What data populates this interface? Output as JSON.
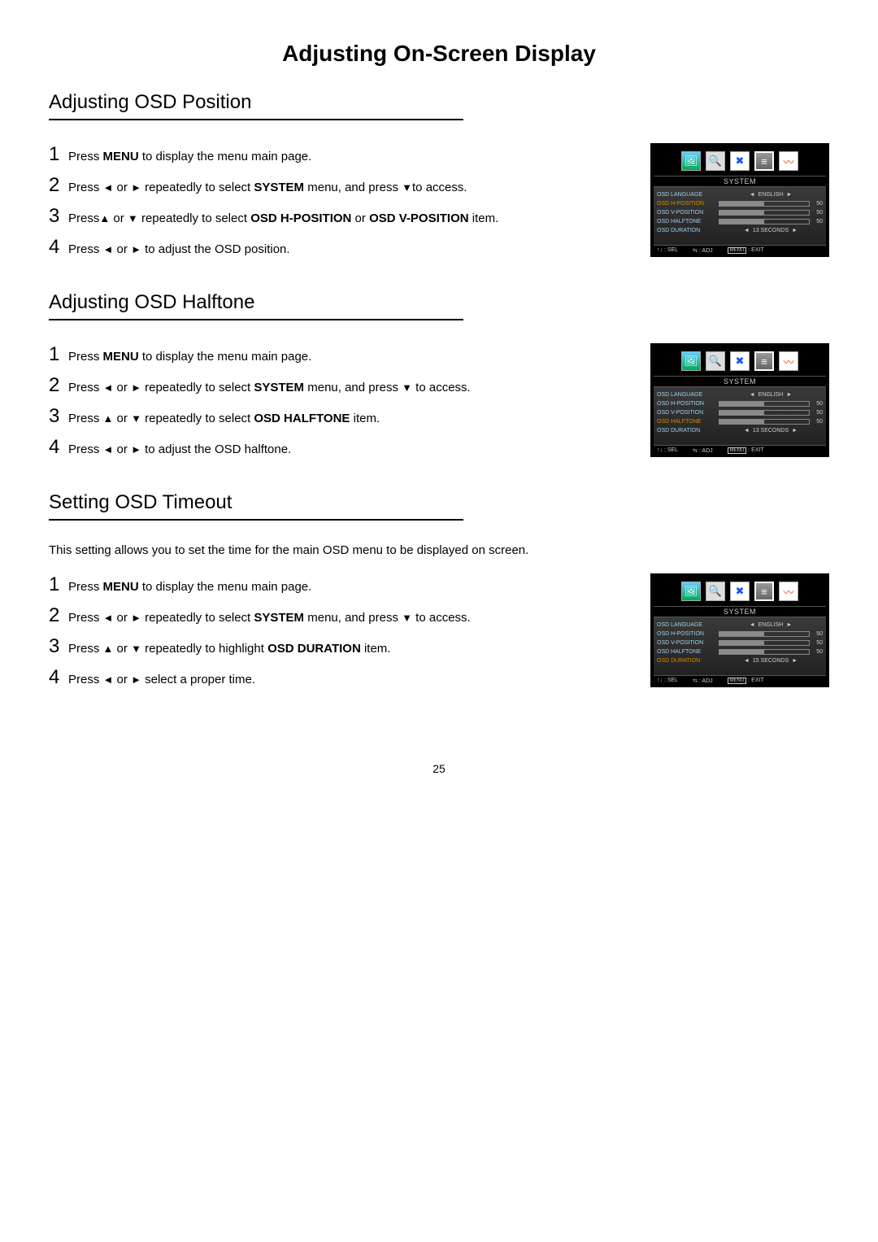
{
  "page_title": "Adjusting On-Screen Display",
  "page_number": "25",
  "arrows": {
    "left": "◄",
    "right": "►",
    "up": "▲",
    "down": "▼",
    "updown": "↑↓",
    "lr_icon": "⇆"
  },
  "sections": {
    "position": {
      "heading": "Adjusting OSD Position",
      "steps": [
        {
          "n": "1",
          "pre": "Press ",
          "b1": "MENU",
          "post1": " to display the menu main page."
        },
        {
          "n": "2",
          "pre": "Press ",
          "arr1": "◄",
          "mid1": " or ",
          "arr2": "►",
          "mid2": " repeatedly to select ",
          "b1": "SYSTEM",
          "post1": " menu, and press ",
          "arr3": "▼",
          "post2": "to access."
        },
        {
          "n": "3",
          "pre": "Press",
          "arr1": "▲",
          "mid1": " or ",
          "arr2": "▼",
          "mid2": " repeatedly to select ",
          "b1": "OSD H-POSITION",
          "mid3": " or ",
          "b2": "OSD V-POSITION",
          "post1": " item."
        },
        {
          "n": "4",
          "pre": "Press ",
          "arr1": "◄",
          "mid1": " or ",
          "arr2": "►",
          "post1": " to adjust the OSD position."
        }
      ]
    },
    "halftone": {
      "heading": "Adjusting OSD Halftone",
      "steps": [
        {
          "n": "1",
          "pre": "Press ",
          "b1": "MENU",
          "post1": " to display the menu main page."
        },
        {
          "n": "2",
          "pre": "Press ",
          "arr1": "◄",
          "mid1": " or ",
          "arr2": "►",
          "mid2": " repeatedly to select ",
          "b1": "SYSTEM",
          "post1": " menu, and press ",
          "arr3": "▼",
          "post2": " to access."
        },
        {
          "n": "3",
          "pre": "Press ",
          "arr1": "▲",
          "mid1": " or ",
          "arr2": "▼",
          "mid2": " repeatedly to select ",
          "b1": "OSD HALFTONE",
          "post1": " item."
        },
        {
          "n": "4",
          "pre": "Press ",
          "arr1": "◄",
          "mid1": " or ",
          "arr2": "►",
          "post1": " to adjust the OSD halftone."
        }
      ]
    },
    "timeout": {
      "heading": "Setting OSD Timeout",
      "intro": "This setting allows you to set the time for the main OSD menu to be displayed on screen.",
      "steps": [
        {
          "n": "1",
          "pre": "Press ",
          "b1": "MENU",
          "post1": " to display the menu main page."
        },
        {
          "n": "2",
          "pre": "Press ",
          "arr1": "◄",
          "mid1": " or ",
          "arr2": "►",
          "mid2": " repeatedly to select ",
          "b1": "SYSTEM",
          "post1": " menu, and press ",
          "arr3": "▼",
          "post2": " to access."
        },
        {
          "n": "3",
          "pre": "Press ",
          "arr1": "▲",
          "mid1": " or ",
          "arr2": "▼",
          "mid2": "  repeatedly to highlight ",
          "b1": "OSD DURATION",
          "post1": " item."
        },
        {
          "n": "4",
          "pre": "Press ",
          "arr1": "◄",
          "mid1": " or ",
          "arr2": "►",
          "post1": " select a proper time."
        }
      ]
    }
  },
  "osd": {
    "title": "SYSTEM",
    "labels": {
      "language": "OSD LANGUAGE",
      "hpos": "OSD H-POSITION",
      "vpos": "OSD V-POSITION",
      "halftone": "OSD HALFTONE",
      "duration": "OSD DURATION"
    },
    "language_value": "ENGLISH",
    "slider_value": "50",
    "duration_13": "13 SECONDS",
    "duration_15": "15 SECONDS",
    "footer": {
      "sel": ": SEL",
      "adj": ": ADJ",
      "menu_label": "MENU",
      "exit": ":  EXIT"
    }
  }
}
